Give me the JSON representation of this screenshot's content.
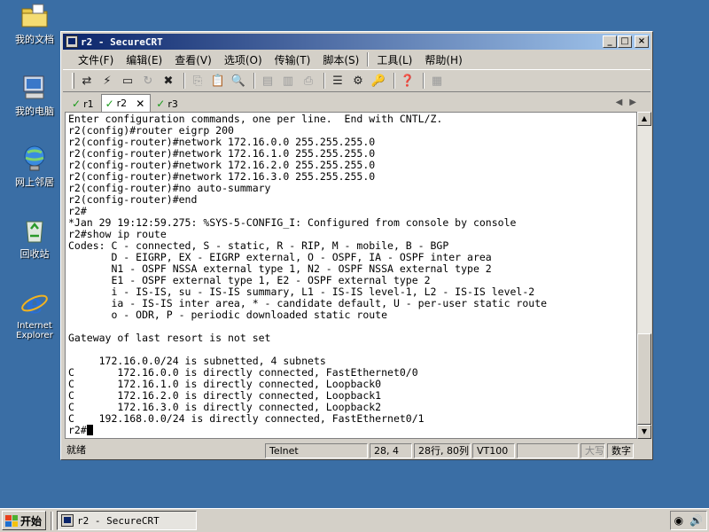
{
  "desktop": {
    "icons": [
      {
        "label": "我的文档",
        "icon": "folder-icon"
      },
      {
        "label": "我的电脑",
        "icon": "computer-icon"
      },
      {
        "label": "网上邻居",
        "icon": "network-icon"
      },
      {
        "label": "回收站",
        "icon": "recycle-bin-icon"
      },
      {
        "label": "Internet Explorer",
        "icon": "ie-icon"
      }
    ]
  },
  "window": {
    "title": "r2 - SecureCRT",
    "controls": {
      "minimize": "_",
      "maximize": "□",
      "close": "×"
    }
  },
  "menu": [
    "文件(F)",
    "编辑(E)",
    "查看(V)",
    "选项(O)",
    "传输(T)",
    "脚本(S)",
    "工具(L)",
    "帮助(H)"
  ],
  "tabs": [
    {
      "label": "r1",
      "active": false
    },
    {
      "label": "r2",
      "active": true
    },
    {
      "label": "r3",
      "active": false
    }
  ],
  "terminal": {
    "lines": [
      "Enter configuration commands, one per line.  End with CNTL/Z.",
      "r2(config)#router eigrp 200",
      "r2(config-router)#network 172.16.0.0 255.255.255.0",
      "r2(config-router)#network 172.16.1.0 255.255.255.0",
      "r2(config-router)#network 172.16.2.0 255.255.255.0",
      "r2(config-router)#network 172.16.3.0 255.255.255.0",
      "r2(config-router)#no auto-summary",
      "r2(config-router)#end",
      "r2#",
      "*Jan 29 19:12:59.275: %SYS-5-CONFIG_I: Configured from console by console",
      "r2#show ip route",
      "Codes: C - connected, S - static, R - RIP, M - mobile, B - BGP",
      "       D - EIGRP, EX - EIGRP external, O - OSPF, IA - OSPF inter area",
      "       N1 - OSPF NSSA external type 1, N2 - OSPF NSSA external type 2",
      "       E1 - OSPF external type 1, E2 - OSPF external type 2",
      "       i - IS-IS, su - IS-IS summary, L1 - IS-IS level-1, L2 - IS-IS level-2",
      "       ia - IS-IS inter area, * - candidate default, U - per-user static route",
      "       o - ODR, P - periodic downloaded static route",
      "",
      "Gateway of last resort is not set",
      "",
      "     172.16.0.0/24 is subnetted, 4 subnets",
      "C       172.16.0.0 is directly connected, FastEthernet0/0",
      "C       172.16.1.0 is directly connected, Loopback0",
      "C       172.16.2.0 is directly connected, Loopback1",
      "C       172.16.3.0 is directly connected, Loopback2",
      "C    192.168.0.0/24 is directly connected, FastEthernet0/1"
    ],
    "prompt": "r2#"
  },
  "status": {
    "ready": "就绪",
    "protocol": "Telnet",
    "cursor_pos": "28,  4",
    "size": "28行, 80列",
    "emulation": "VT100",
    "blank": "",
    "caps": "大写",
    "num": "数字"
  },
  "taskbar": {
    "start_label": "开始",
    "task_label": "r2 - SecureCRT"
  }
}
